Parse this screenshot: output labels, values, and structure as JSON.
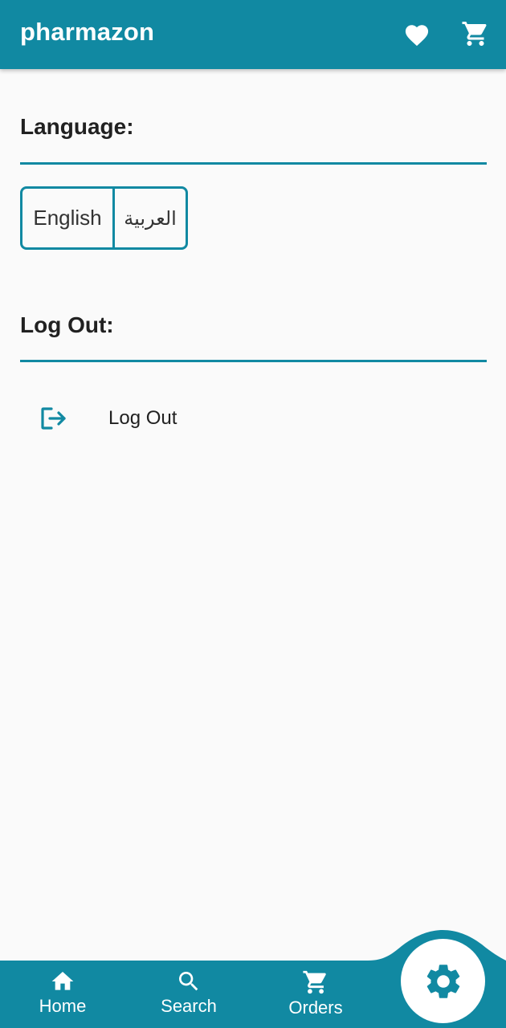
{
  "app": {
    "title": "pharmazon",
    "brand_color": "#1189a2"
  },
  "appbar": {
    "favorites_icon": "heart-icon",
    "cart_icon": "shopping-cart-icon"
  },
  "language_section": {
    "title": "Language:",
    "options": [
      "English",
      "العربية"
    ]
  },
  "logout_section": {
    "title": "Log Out:",
    "item_label": "Log Out",
    "item_icon": "logout-icon"
  },
  "bottom_nav": {
    "items": [
      {
        "label": "Home",
        "icon": "home-icon"
      },
      {
        "label": "Search",
        "icon": "search-icon"
      },
      {
        "label": "Orders",
        "icon": "cart-icon"
      }
    ],
    "active_icon": "gear-icon"
  }
}
